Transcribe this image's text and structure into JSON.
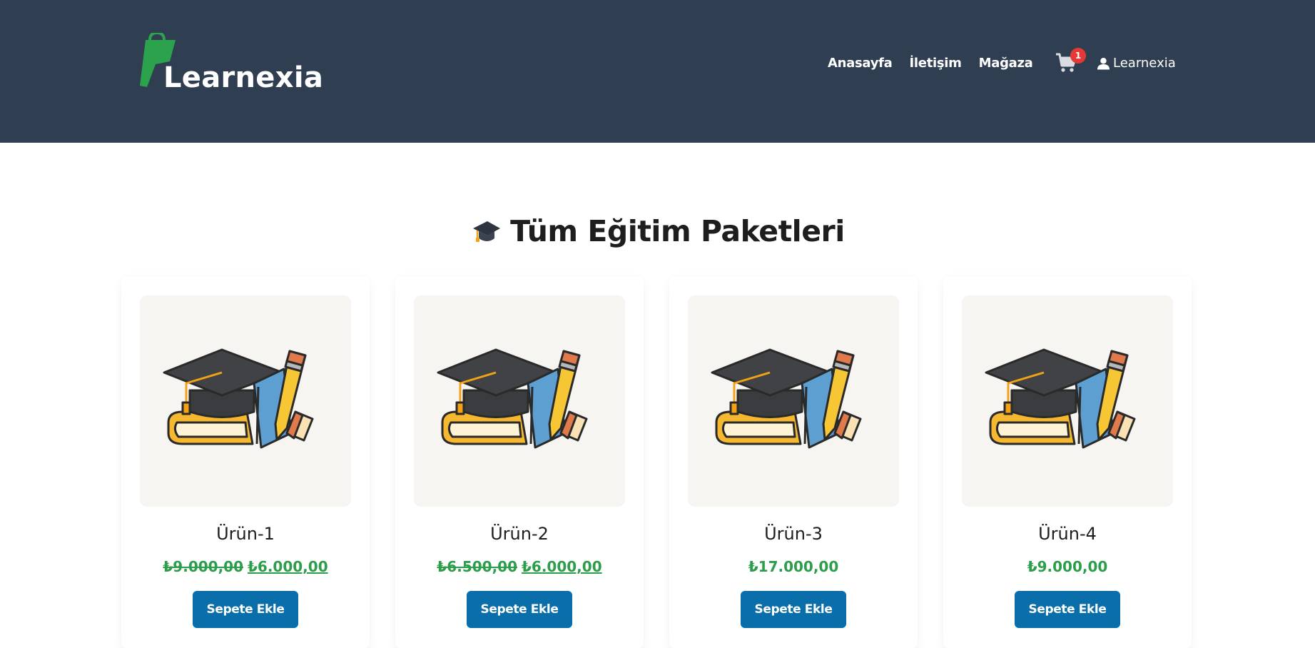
{
  "header": {
    "logo_text": "Learnexia",
    "nav": [
      {
        "label": "Anasayfa"
      },
      {
        "label": "İletişim"
      },
      {
        "label": "Mağaza"
      }
    ],
    "cart_count": "1",
    "user_label": "Learnexia"
  },
  "main": {
    "title": "Tüm Eğitim Paketleri",
    "products": [
      {
        "name": "Ürün-1",
        "old_price": "₺9.000,00",
        "price": "₺6.000,00",
        "button": "Sepete Ekle"
      },
      {
        "name": "Ürün-2",
        "old_price": "₺6.500,00",
        "price": "₺6.000,00",
        "button": "Sepete Ekle"
      },
      {
        "name": "Ürün-3",
        "old_price": "",
        "price": "₺17.000,00",
        "button": "Sepete Ekle"
      },
      {
        "name": "Ürün-4",
        "old_price": "",
        "price": "₺9.000,00",
        "button": "Sepete Ekle"
      }
    ]
  },
  "colors": {
    "header_bg": "#2f3e50",
    "logo_green": "#2ca24c",
    "price_green": "#2c9e4b",
    "button_blue": "#0a6eaa",
    "badge_red": "#e53935"
  },
  "icons": {
    "logo": "shopping-bag-icon",
    "cart": "cart-icon",
    "user": "user-icon",
    "title": "graduation-cap-icon",
    "product_image": "education-illustration"
  }
}
